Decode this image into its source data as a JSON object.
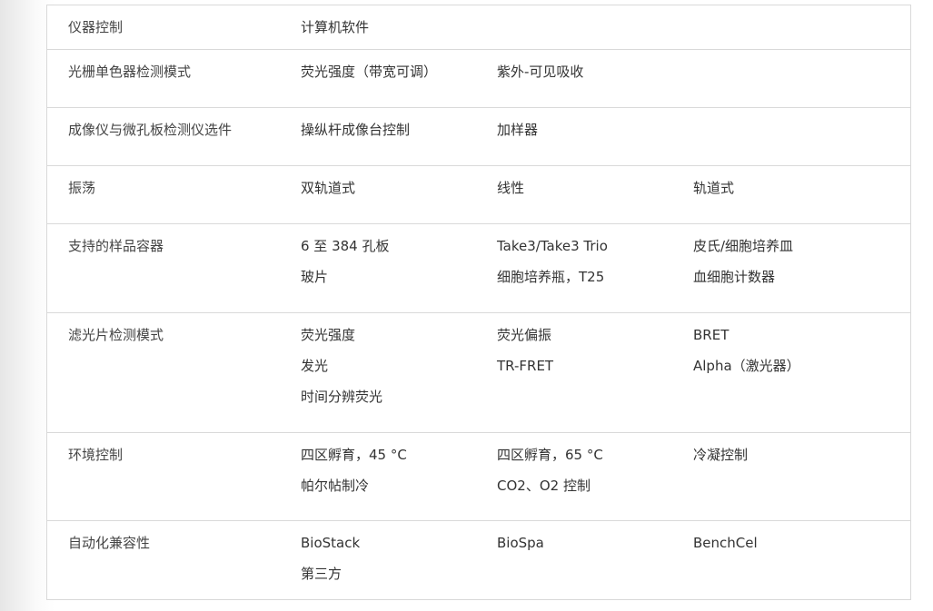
{
  "rows": [
    {
      "label": "仪器控制",
      "col1": [
        "计算机软件"
      ],
      "col2": [],
      "col3": []
    },
    {
      "label": "光栅单色器检测模式",
      "col1": [
        "荧光强度（带宽可调）"
      ],
      "col2": [
        "紫外-可见吸收"
      ],
      "col3": []
    },
    {
      "label": "成像仪与微孔板检测仪选件",
      "col1": [
        "操纵杆成像台控制"
      ],
      "col2": [
        "加样器"
      ],
      "col3": []
    },
    {
      "label": "振荡",
      "col1": [
        "双轨道式"
      ],
      "col2": [
        "线性"
      ],
      "col3": [
        "轨道式"
      ]
    },
    {
      "label": "支持的样品容器",
      "col1": [
        "6 至 384 孔板",
        "玻片"
      ],
      "col2": [
        "Take3/Take3 Trio",
        "细胞培养瓶，T25"
      ],
      "col3": [
        "皮氏/细胞培养皿",
        "血细胞计数器"
      ]
    },
    {
      "label": "滤光片检测模式",
      "col1": [
        "荧光强度",
        "发光",
        "时间分辨荧光"
      ],
      "col2": [
        "荧光偏振",
        "TR-FRET"
      ],
      "col3": [
        "BRET",
        "Alpha（激光器）"
      ]
    },
    {
      "label": "环境控制",
      "col1": [
        "四区孵育，45 °C",
        "帕尔帖制冷"
      ],
      "col2": [
        "四区孵育，65 °C",
        "CO2、O2 控制"
      ],
      "col3": [
        "冷凝控制"
      ]
    },
    {
      "label": "自动化兼容性",
      "col1": [
        "BioStack",
        "第三方"
      ],
      "col2": [
        "BioSpa"
      ],
      "col3": [
        "BenchCel"
      ]
    }
  ]
}
